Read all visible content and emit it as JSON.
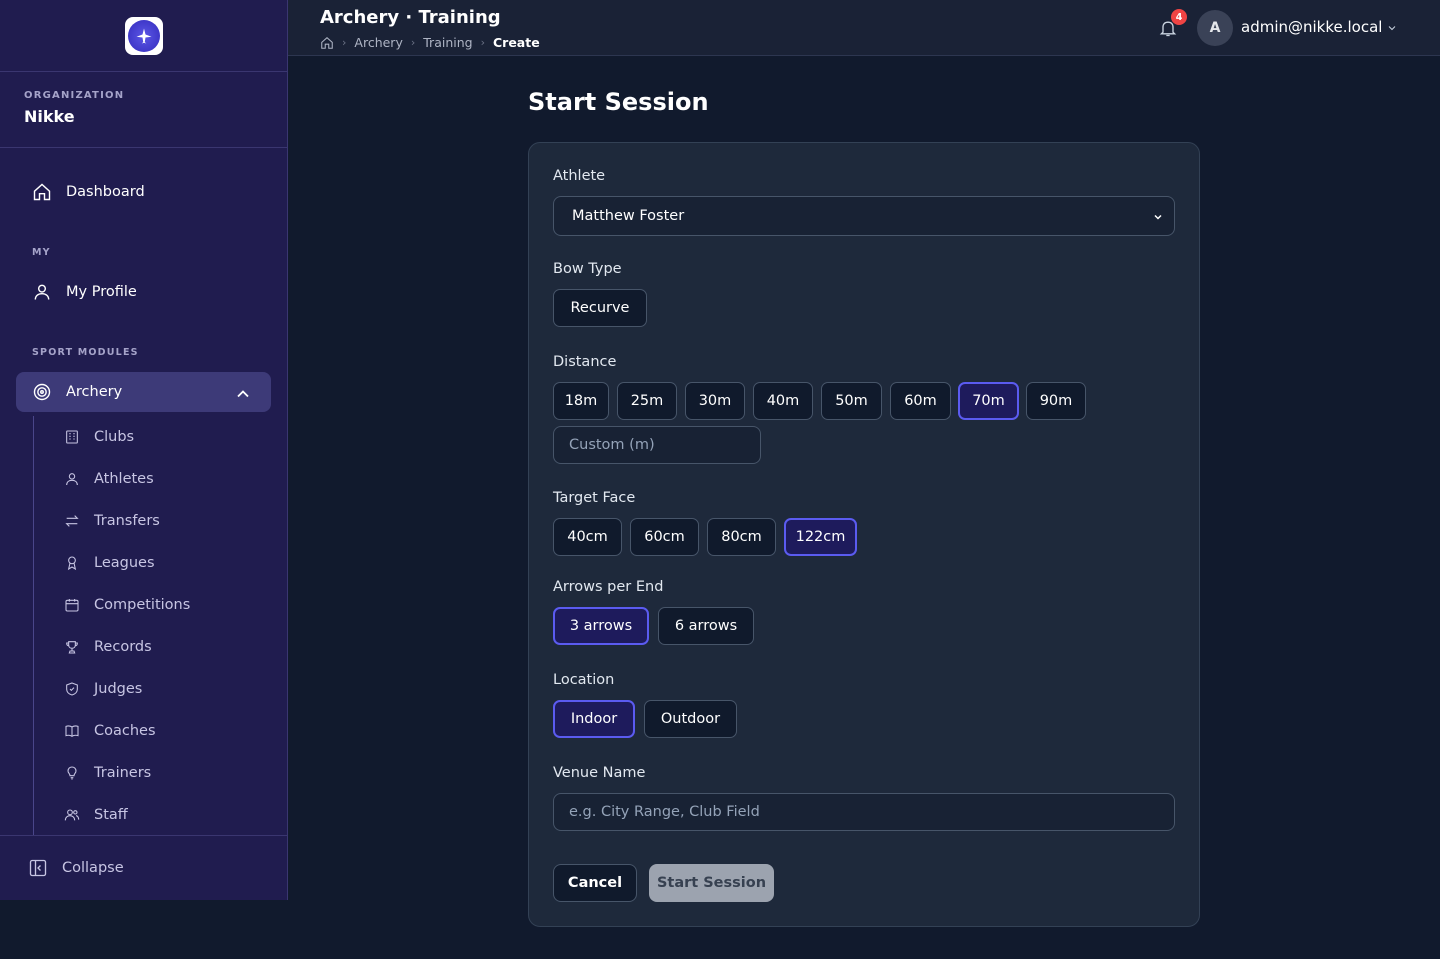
{
  "sidebar": {
    "org_label": "ORGANIZATION",
    "org_name": "Nikke",
    "dashboard": "Dashboard",
    "section_my": "MY",
    "my_profile": "My Profile",
    "section_sport": "SPORT MODULES",
    "archery": "Archery",
    "sub_items": [
      {
        "label": "Clubs",
        "icon": "building-icon"
      },
      {
        "label": "Athletes",
        "icon": "user-icon"
      },
      {
        "label": "Transfers",
        "icon": "transfer-icon"
      },
      {
        "label": "Leagues",
        "icon": "ribbon-icon"
      },
      {
        "label": "Competitions",
        "icon": "calendar-icon"
      },
      {
        "label": "Records",
        "icon": "trophy-icon"
      },
      {
        "label": "Judges",
        "icon": "shield-icon"
      },
      {
        "label": "Coaches",
        "icon": "book-icon"
      },
      {
        "label": "Trainers",
        "icon": "bulb-icon"
      },
      {
        "label": "Staff",
        "icon": "users-icon"
      }
    ],
    "collapse": "Collapse"
  },
  "header": {
    "title": "Archery · Training",
    "breadcrumb": [
      "Archery",
      "Training",
      "Create"
    ],
    "notification_count": "4",
    "avatar_initial": "A",
    "user_email": "admin@nikke.local"
  },
  "page": {
    "title": "Start Session"
  },
  "form": {
    "athlete_label": "Athlete",
    "athlete_value": "Matthew Foster",
    "bow_type_label": "Bow Type",
    "bow_types": [
      "Recurve"
    ],
    "distance_label": "Distance",
    "distances": [
      "18m",
      "25m",
      "30m",
      "40m",
      "50m",
      "60m",
      "70m",
      "90m"
    ],
    "distance_selected": "70m",
    "custom_placeholder": "Custom (m)",
    "target_face_label": "Target Face",
    "target_faces": [
      "40cm",
      "60cm",
      "80cm",
      "122cm"
    ],
    "target_face_selected": "122cm",
    "arrows_label": "Arrows per End",
    "arrows": [
      "3 arrows",
      "6 arrows"
    ],
    "arrows_selected": "3 arrows",
    "location_label": "Location",
    "locations": [
      "Indoor",
      "Outdoor"
    ],
    "location_selected": "Indoor",
    "venue_label": "Venue Name",
    "venue_placeholder": "e.g. City Range, Club Field",
    "cancel": "Cancel",
    "submit": "Start Session"
  },
  "colors": {
    "sidebar_bg": "#201c4f",
    "selected_border": "#5b5bf0",
    "page_bg": "#111a2d",
    "badge": "#ef4444"
  }
}
